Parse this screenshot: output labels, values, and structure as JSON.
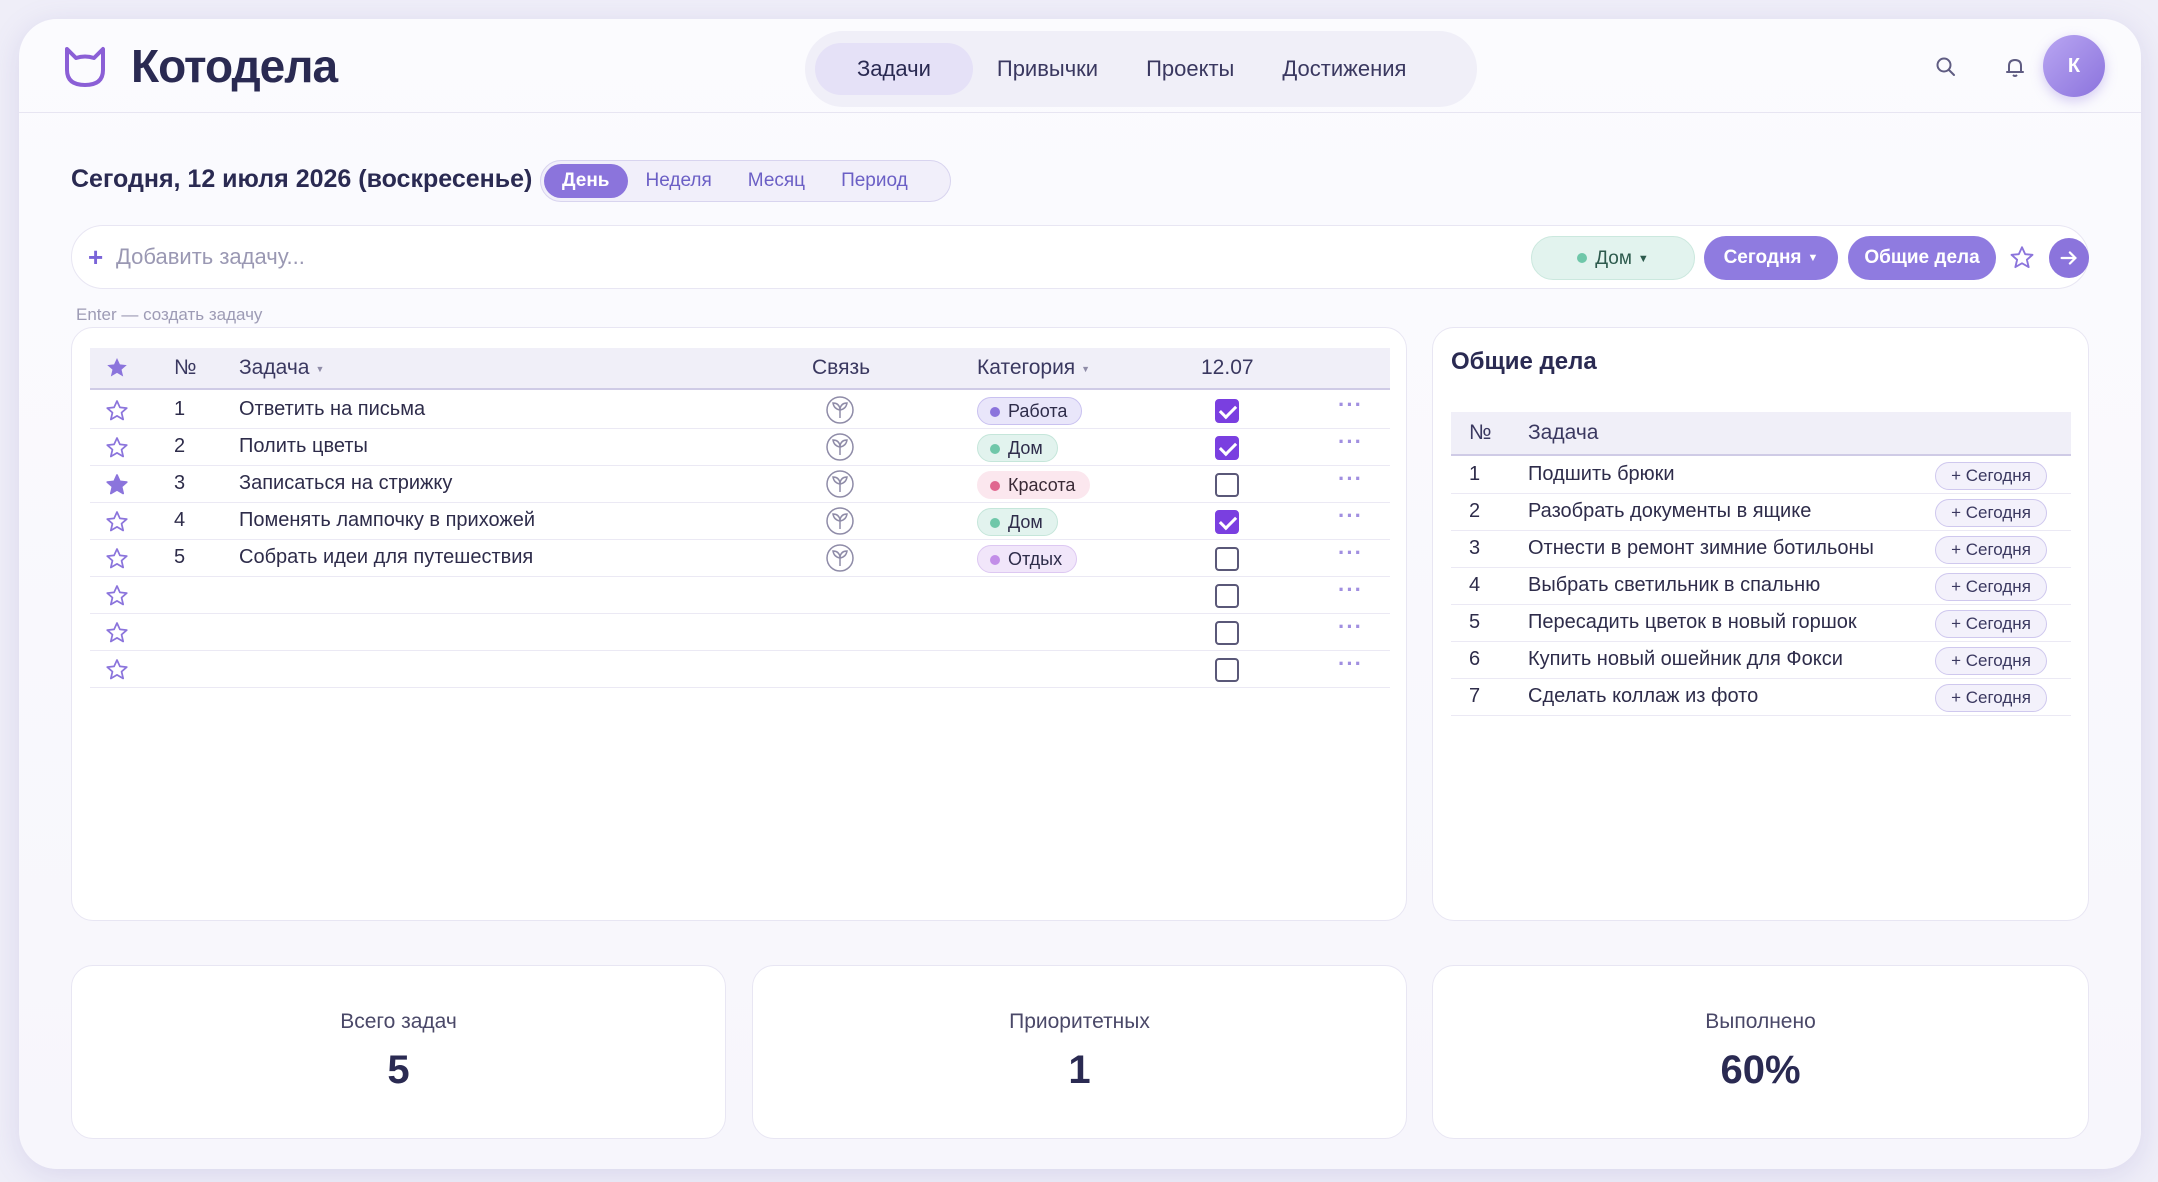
{
  "app": {
    "title": "Котодела",
    "avatar_letter": "К"
  },
  "nav": {
    "tabs": [
      "Задачи",
      "Привычки",
      "Проекты",
      "Достижения"
    ],
    "active": 0
  },
  "date": {
    "title": "Сегодня, 12 июля 2026 (воскресенье)"
  },
  "period": {
    "tabs": [
      "День",
      "Неделя",
      "Месяц",
      "Период"
    ],
    "active": 0
  },
  "add": {
    "placeholder": "Добавить задачу...",
    "category_chip": "Дом",
    "today_chip": "Сегодня",
    "general_chip": "Общие дела",
    "hint": "Enter — создать задачу"
  },
  "tasks_table": {
    "headers": {
      "num": "№",
      "task": "Задача",
      "link": "Связь",
      "category": "Категория",
      "date": "12.07"
    },
    "rows": [
      {
        "starred": false,
        "num": "1",
        "task": "Ответить на письма",
        "category": "Работа",
        "cat_bg": "#e9e6fa",
        "cat_border": "#c9c1f0",
        "cat_dot": "#8b74dc",
        "cat_color": "#2e2c4a",
        "done": true
      },
      {
        "starred": false,
        "num": "2",
        "task": "Полить цветы",
        "category": "Дом",
        "cat_bg": "#e2f3ee",
        "cat_border": "#c5e6da",
        "cat_dot": "#6fc7a9",
        "cat_color": "#2e2c4a",
        "done": true
      },
      {
        "starred": true,
        "num": "3",
        "task": "Записаться на стрижку",
        "category": "Красота",
        "cat_bg": "#fbe7ee",
        "cat_border": "#fbe7ee",
        "cat_dot": "#e0678f",
        "cat_color": "#3a2a36",
        "done": false
      },
      {
        "starred": false,
        "num": "4",
        "task": "Поменять лампочку в прихожей",
        "category": "Дом",
        "cat_bg": "#e2f3ee",
        "cat_border": "#c5e6da",
        "cat_dot": "#6fc7a9",
        "cat_color": "#2e2c4a",
        "done": true
      },
      {
        "starred": false,
        "num": "5",
        "task": "Собрать идеи для путешествия",
        "category": "Отдых",
        "cat_bg": "#f1e6fa",
        "cat_border": "#ddc8f2",
        "cat_dot": "#c28ee8",
        "cat_color": "#2e2c4a",
        "done": false
      },
      {
        "starred": false,
        "num": "",
        "task": "",
        "category": "",
        "done": false
      },
      {
        "starred": false,
        "num": "",
        "task": "",
        "category": "",
        "done": false
      },
      {
        "starred": false,
        "num": "",
        "task": "",
        "category": "",
        "done": false
      }
    ]
  },
  "general": {
    "title": "Общие дела",
    "headers": {
      "num": "№",
      "task": "Задача"
    },
    "button_label": "+ Сегодня",
    "rows": [
      {
        "num": "1",
        "task": "Подшить брюки"
      },
      {
        "num": "2",
        "task": "Разобрать документы в ящике"
      },
      {
        "num": "3",
        "task": "Отнести в ремонт зимние ботильоны"
      },
      {
        "num": "4",
        "task": "Выбрать светильник в спальню"
      },
      {
        "num": "5",
        "task": "Пересадить цветок в новый горшок"
      },
      {
        "num": "6",
        "task": "Купить новый ошейник для Фокси"
      },
      {
        "num": "7",
        "task": "Сделать коллаж из фото"
      }
    ]
  },
  "stats": [
    {
      "label": "Всего задач",
      "value": "5"
    },
    {
      "label": "Приоритетных",
      "value": "1"
    },
    {
      "label": "Выполнено",
      "value": "60%"
    }
  ]
}
